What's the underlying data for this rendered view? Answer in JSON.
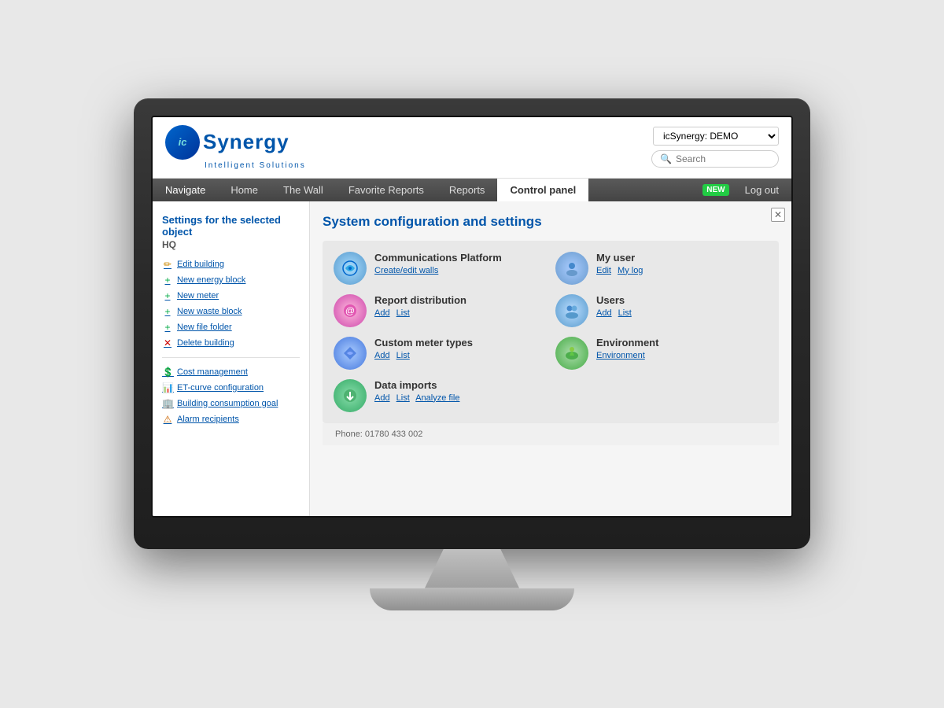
{
  "app": {
    "title": "icSynergy",
    "logo_text": "Synergy",
    "logo_letter": "ic",
    "tagline": "Intelligent Solutions",
    "demo_label": "icSynergy: DEMO"
  },
  "search": {
    "placeholder": "Search"
  },
  "nav": {
    "items": [
      {
        "label": "Navigate",
        "id": "navigate",
        "active": false
      },
      {
        "label": "Home",
        "id": "home",
        "active": false
      },
      {
        "label": "The Wall",
        "id": "the-wall",
        "active": false
      },
      {
        "label": "Favorite Reports",
        "id": "favorite-reports",
        "active": false
      },
      {
        "label": "Reports",
        "id": "reports",
        "active": false
      },
      {
        "label": "Control panel",
        "id": "control-panel",
        "active": true
      }
    ],
    "new_badge": "NEW",
    "logout_label": "Log out"
  },
  "sidebar": {
    "title": "Settings for the selected object",
    "subtitle": "HQ",
    "links_primary": [
      {
        "label": "Edit building",
        "icon": "✏️",
        "style": "yellow"
      },
      {
        "label": "New energy block",
        "icon": "+",
        "style": "green"
      },
      {
        "label": "New meter",
        "icon": "+",
        "style": "green"
      },
      {
        "label": "New waste block",
        "icon": "+",
        "style": "green"
      },
      {
        "label": "New file folder",
        "icon": "+",
        "style": "green"
      },
      {
        "label": "Delete building",
        "icon": "✕",
        "style": "red"
      }
    ],
    "links_secondary": [
      {
        "label": "Cost management",
        "icon": "💰",
        "style": "yellow"
      },
      {
        "label": "ET-curve configuration",
        "icon": "📈",
        "style": "orange"
      },
      {
        "label": "Building consumption goal",
        "icon": "🏢",
        "style": "blue-icon"
      },
      {
        "label": "Alarm recipients",
        "icon": "⚠️",
        "style": "orange"
      }
    ]
  },
  "content": {
    "title": "System configuration and settings",
    "items": [
      {
        "id": "comm-platform",
        "icon_type": "comm",
        "title": "Communications Platform",
        "links": [
          "Create/edit walls"
        ]
      },
      {
        "id": "my-user",
        "icon_type": "myuser",
        "title": "My user",
        "links": [
          "Edit",
          "My log"
        ]
      },
      {
        "id": "report-dist",
        "icon_type": "report",
        "title": "Report distribution",
        "links": [
          "Add",
          "List"
        ]
      },
      {
        "id": "users",
        "icon_type": "users",
        "title": "Users",
        "links": [
          "Add",
          "List"
        ]
      },
      {
        "id": "custom-meter",
        "icon_type": "custom",
        "title": "Custom meter types",
        "links": [
          "Add",
          "List"
        ]
      },
      {
        "id": "environment",
        "icon_type": "env",
        "title": "Environment",
        "links": [
          "Environment"
        ]
      },
      {
        "id": "data-imports",
        "icon_type": "data",
        "title": "Data imports",
        "links": [
          "Add",
          "List",
          "Analyze file"
        ]
      }
    ]
  },
  "footer": {
    "phone": "Phone: 01780 433 002"
  }
}
